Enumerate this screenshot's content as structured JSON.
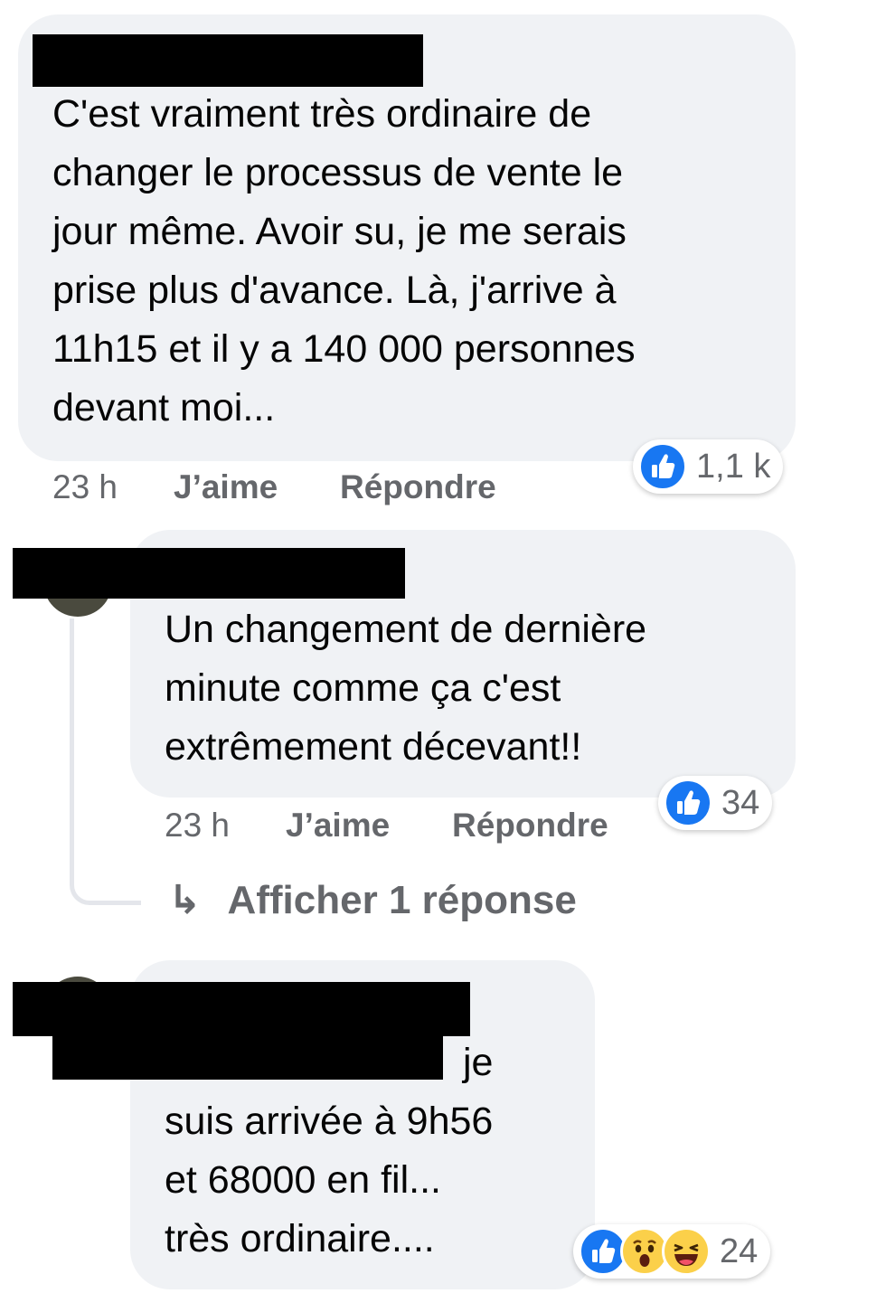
{
  "comments": [
    {
      "text": "C'est vraiment très ordinaire de\nchanger le processus de vente le\njour même. Avoir su, je me serais\nprise plus d'avance. Là, j'arrive à\n11h15 et il y a 140 000 personnes\ndevant moi...",
      "time": "23 h",
      "like_label": "J’aime",
      "reply_label": "Répondre",
      "reaction_count": "1,1 k",
      "reactions": [
        "like-icon"
      ]
    },
    {
      "text": "Un changement de dernière\nminute comme ça c'est\nextrêmement décevant!!",
      "time": "23 h",
      "like_label": "J’aime",
      "reply_label": "Répondre",
      "reaction_count": "34",
      "reactions": [
        "like-icon"
      ],
      "view_replies": "Afficher 1 réponse",
      "view_replies_icon": "↳"
    },
    {
      "text_partial": "je",
      "text": "suis arrivée à 9h56\net 68000 en fil...\ntrès ordinaire....",
      "reaction_count": "24",
      "reactions": [
        "like-icon",
        "wow-icon",
        "haha-icon"
      ]
    }
  ],
  "colors": {
    "bubble": "#f0f2f5",
    "meta_text": "#65676b",
    "like_blue": "#1877f2",
    "emoji_yellow": "#fbd04a"
  }
}
